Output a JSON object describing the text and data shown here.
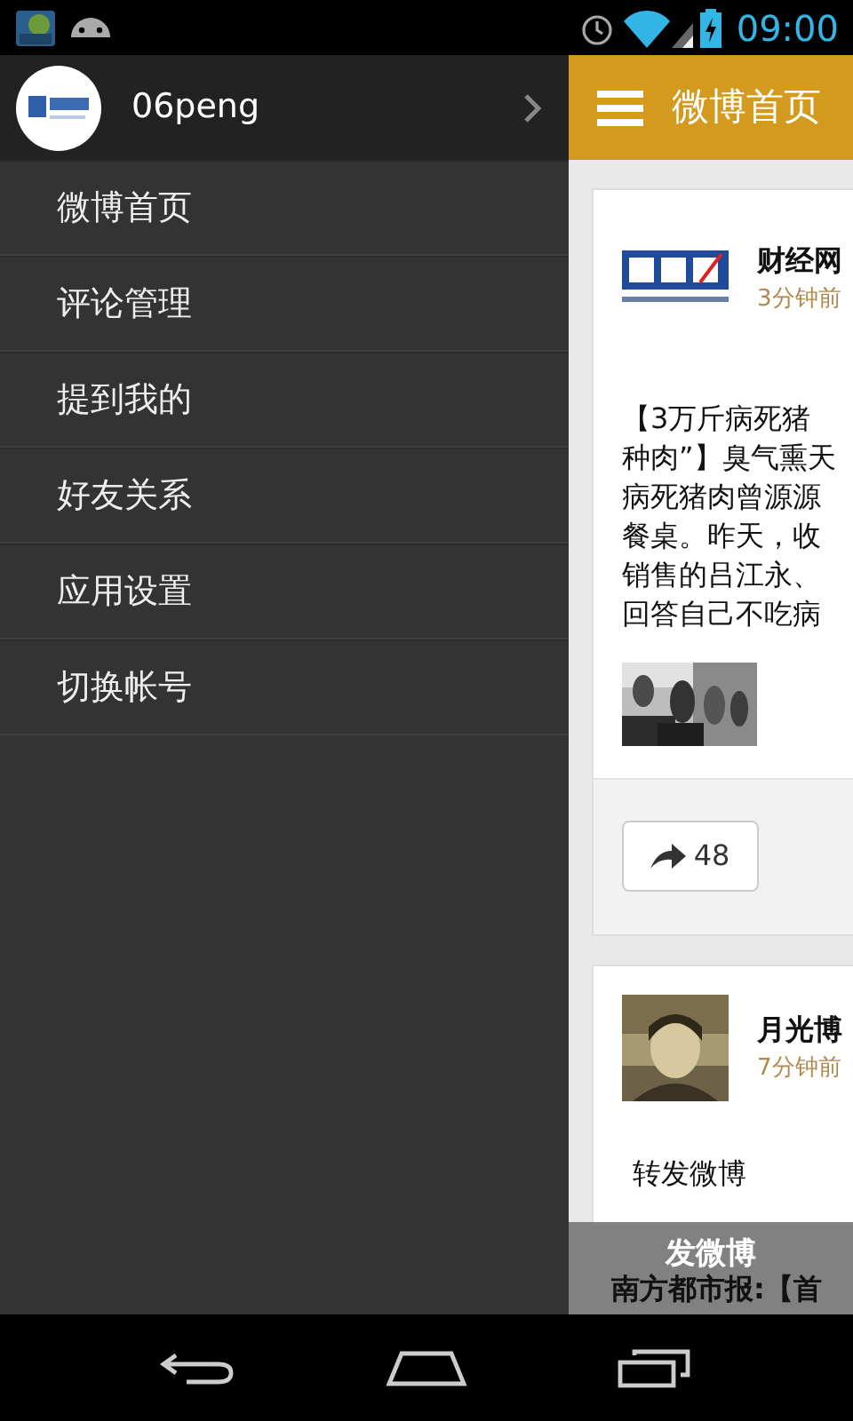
{
  "status_bar": {
    "time": "09:00"
  },
  "drawer": {
    "account": {
      "name": "06peng"
    },
    "items": [
      {
        "label": "微博首页"
      },
      {
        "label": "评论管理"
      },
      {
        "label": "提到我的"
      },
      {
        "label": "好友关系"
      },
      {
        "label": "应用设置"
      },
      {
        "label": "切换帐号"
      }
    ]
  },
  "header": {
    "title": "微博首页"
  },
  "posts": [
    {
      "kind": "logo",
      "author": "财经网",
      "time": "3分钟前",
      "lines": [
        "【3万斤病死猪",
        "种肉”】臭气熏天",
        "病死猪肉曾源源",
        "餐桌。昨天，收",
        "销售的吕江永、",
        "回答自己不吃病"
      ],
      "repost_count": "48"
    },
    {
      "author": "月光博",
      "time": "7分钟前",
      "lines": [
        "转发微博"
      ]
    }
  ],
  "compose_bar": {
    "label": "发微博"
  },
  "next_post_preview": "南方都市报:【首"
}
